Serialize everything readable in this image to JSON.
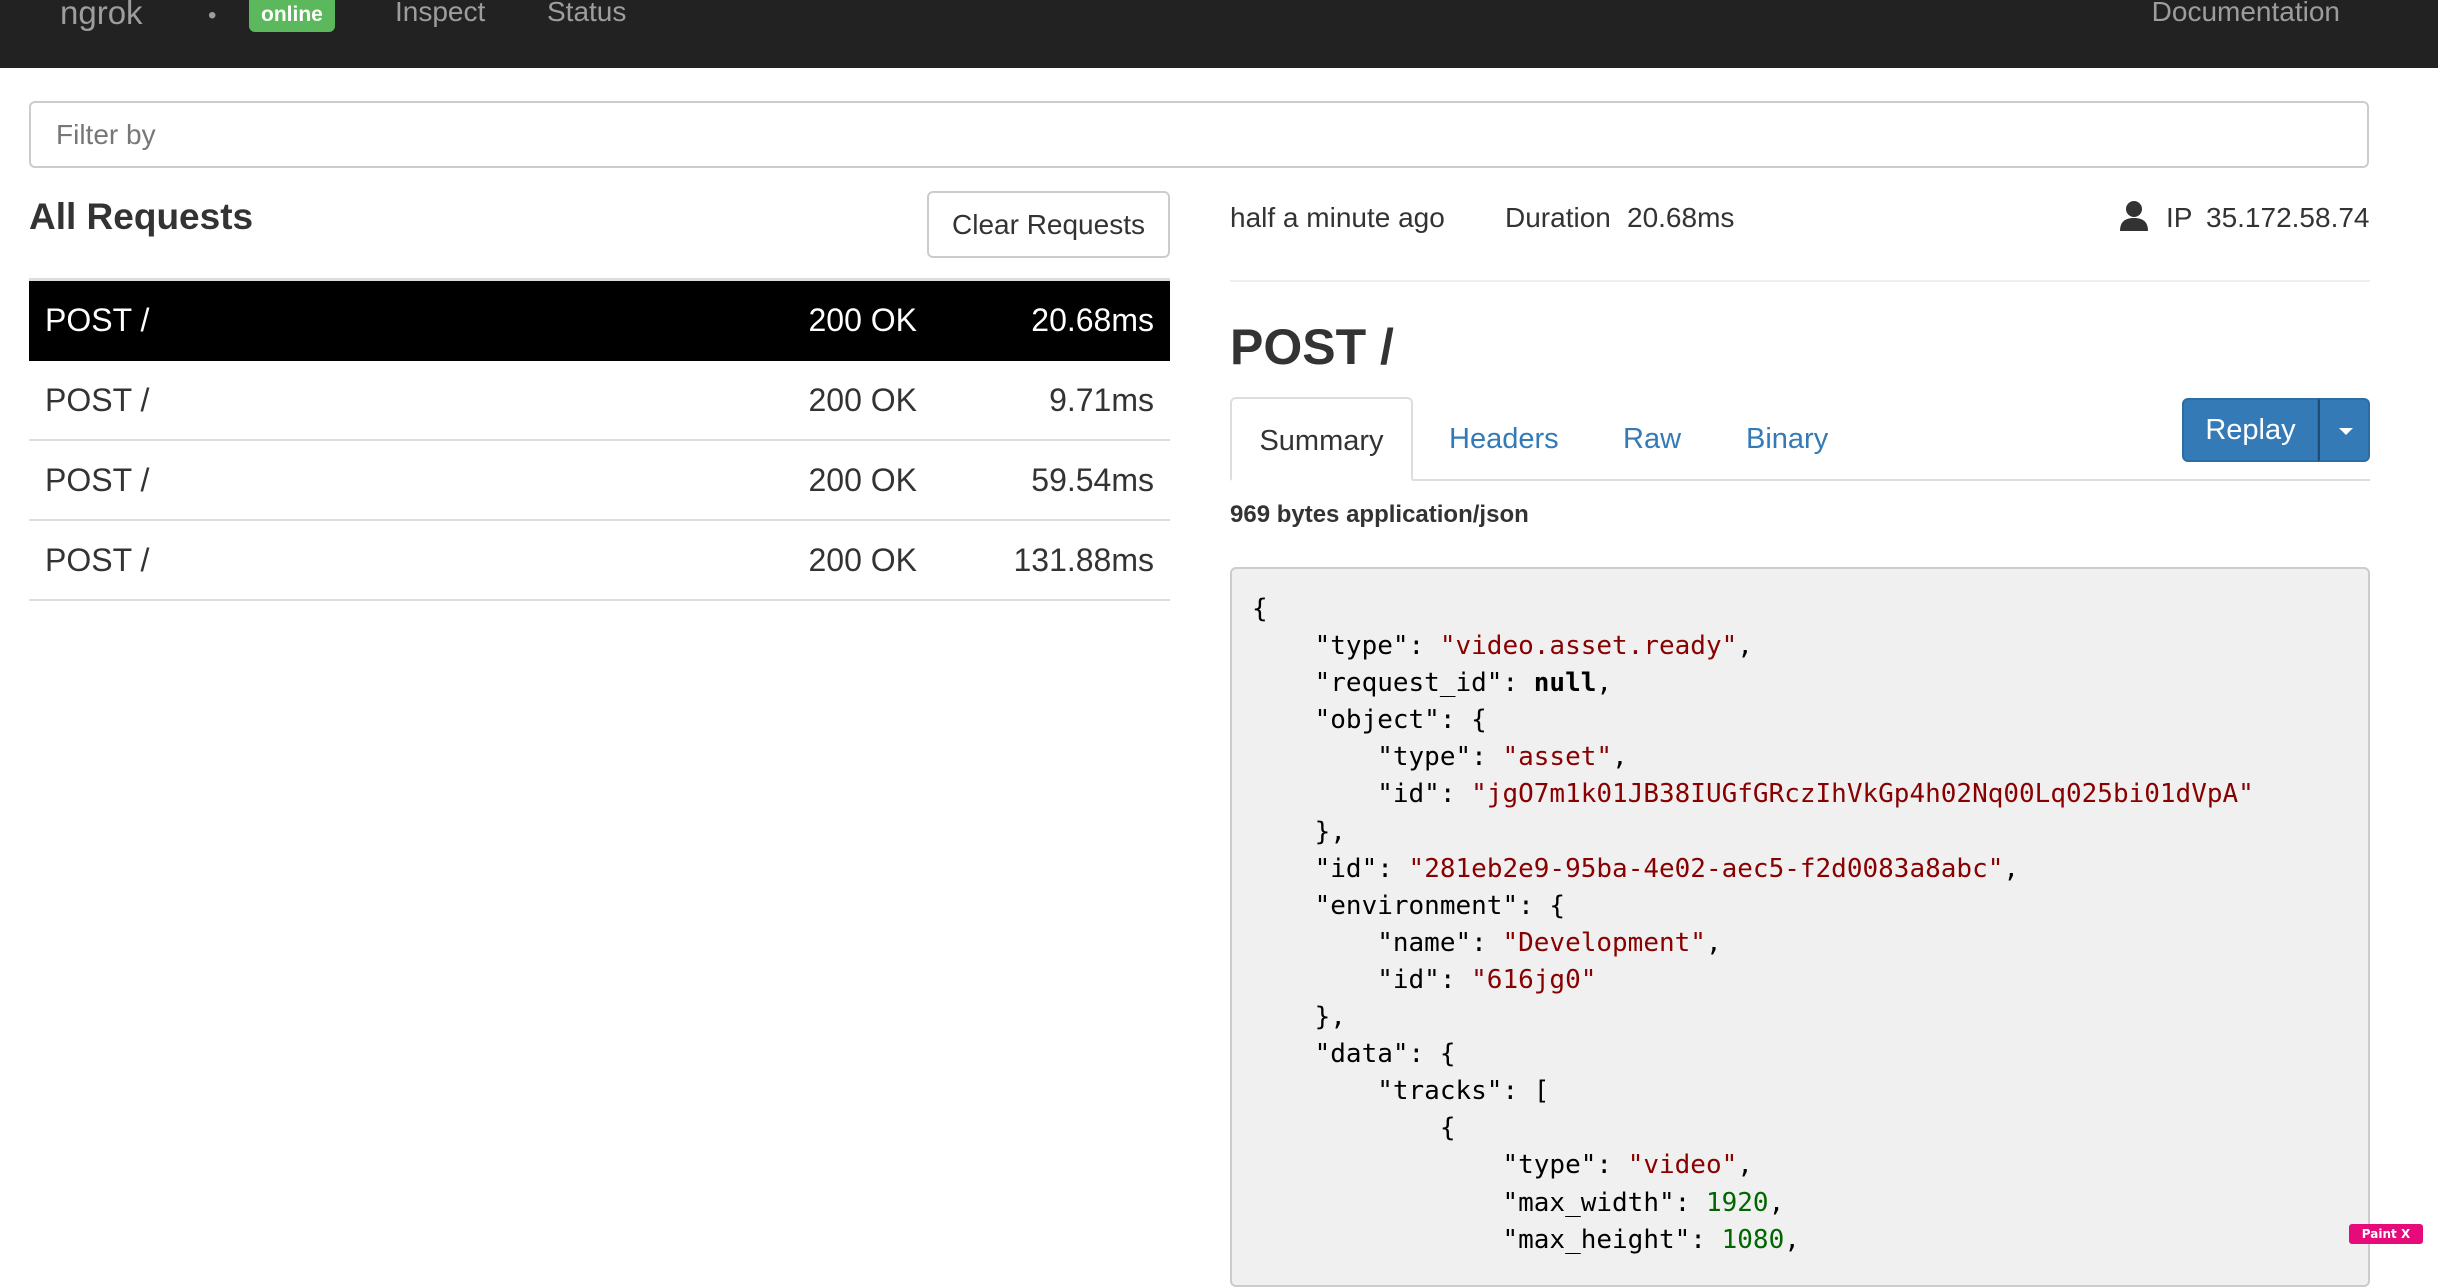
{
  "nav": {
    "brand": "ngrok",
    "separator": "•",
    "status_badge": "online",
    "status_color": "#5cb85c",
    "links": [
      "Inspect",
      "Status"
    ],
    "docs_link": "Documentation"
  },
  "filter": {
    "placeholder": "Filter by",
    "value": ""
  },
  "requests": {
    "title": "All Requests",
    "clear_label": "Clear Requests",
    "selected_index": 0,
    "rows": [
      {
        "method": "POST /",
        "status": "200 OK",
        "duration": "20.68ms"
      },
      {
        "method": "POST /",
        "status": "200 OK",
        "duration": "9.71ms"
      },
      {
        "method": "POST /",
        "status": "200 OK",
        "duration": "59.54ms"
      },
      {
        "method": "POST /",
        "status": "200 OK",
        "duration": "131.88ms"
      }
    ]
  },
  "detail": {
    "time": "half a minute ago",
    "duration_label": "Duration",
    "duration": "20.68ms",
    "user_icon": "user-icon",
    "ip_label": "IP",
    "ip": "35.172.58.74",
    "title": "POST /",
    "tabs": [
      "Summary",
      "Headers",
      "Raw",
      "Binary"
    ],
    "active_tab": "Summary",
    "replay_label": "Replay",
    "body_info": "969 bytes application/json",
    "link_color": "#337ab7",
    "replay_color": "#337ab7",
    "code_lines": [
      [
        [
          "p",
          "{"
        ]
      ],
      [
        [
          "p",
          "    \"type\": "
        ],
        [
          "s",
          "\"video.asset.ready\""
        ],
        [
          "p",
          ","
        ]
      ],
      [
        [
          "p",
          "    \"request_id\": "
        ],
        [
          "k",
          "null"
        ],
        [
          "p",
          ","
        ]
      ],
      [
        [
          "p",
          "    \"object\": {"
        ]
      ],
      [
        [
          "p",
          "        \"type\": "
        ],
        [
          "s",
          "\"asset\""
        ],
        [
          "p",
          ","
        ]
      ],
      [
        [
          "p",
          "        \"id\": "
        ],
        [
          "s",
          "\"jgO7m1k01JB38IUGfGRczIhVkGp4h02Nq00Lq025bi01dVpA\""
        ]
      ],
      [
        [
          "p",
          "    },"
        ]
      ],
      [
        [
          "p",
          "    \"id\": "
        ],
        [
          "s",
          "\"281eb2e9-95ba-4e02-aec5-f2d0083a8abc\""
        ],
        [
          "p",
          ","
        ]
      ],
      [
        [
          "p",
          "    \"environment\": {"
        ]
      ],
      [
        [
          "p",
          "        \"name\": "
        ],
        [
          "s",
          "\"Development\""
        ],
        [
          "p",
          ","
        ]
      ],
      [
        [
          "p",
          "        \"id\": "
        ],
        [
          "s",
          "\"616jg0\""
        ]
      ],
      [
        [
          "p",
          "    },"
        ]
      ],
      [
        [
          "p",
          "    \"data\": {"
        ]
      ],
      [
        [
          "p",
          "        \"tracks\": ["
        ]
      ],
      [
        [
          "p",
          "            {"
        ]
      ],
      [
        [
          "p",
          "                \"type\": "
        ],
        [
          "s",
          "\"video\""
        ],
        [
          "p",
          ","
        ]
      ],
      [
        [
          "p",
          "                \"max_width\": "
        ],
        [
          "n",
          "1920"
        ],
        [
          "p",
          ","
        ]
      ],
      [
        [
          "p",
          "                \"max_height\": "
        ],
        [
          "n",
          "1080"
        ],
        [
          "p",
          ","
        ]
      ]
    ]
  },
  "extension_badge": "Paint X Lite"
}
